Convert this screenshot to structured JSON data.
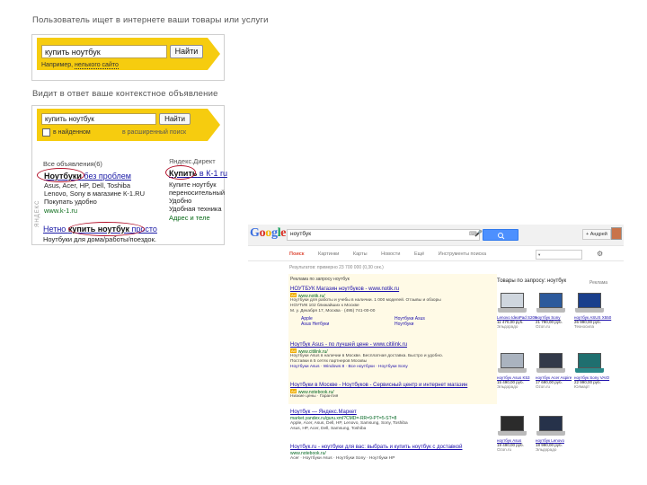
{
  "yandex": {
    "caption_top": "Пользователь ищет в интернете ваши товары или услуги",
    "caption_mid": "Видит в ответ ваше контекстное объявление",
    "box1": {
      "query": "купить ноутбук",
      "button": "Найти",
      "hint_prefix": "Например, ",
      "hint_link": "нелького сайто"
    },
    "box2": {
      "query": "купить ноутбук",
      "button": "Найти",
      "checkbox_label": "в найденном",
      "hint": "в расширенный поиск",
      "left_header": "Все объявления(6)",
      "ad1_title_link": "Ноутбуки",
      "ad1_title_rest": " без проблем",
      "ad1_lines": [
        "Asus, Acer, HP, Dell, Toshiba",
        "Lenovo, Sony в магазине К-1.RU",
        "Покупать удобно"
      ],
      "ad1_url": "www.k-1.ru",
      "right_header": "Яндекс.Директ",
      "ad2_title_link": "Купить",
      "ad2_title_rest": " в К-1 ru",
      "ad2_lines": [
        "Купите ноутбук",
        "переносительный",
        "Удобно",
        "Удобная техника"
      ],
      "ad2_url": "Адрес и теле",
      "ad3_title_prefix": "Нетно ",
      "ad3_title_link": "купить ноутбук",
      "ad3_title_rest": " просто",
      "ad3_line": "Ноутбуки для дома/работы/поездок.",
      "vertical_logo": "ЯНДЕКС"
    }
  },
  "google": {
    "logo": "Google",
    "query": "ноутбук",
    "user_button": "+ Андрей",
    "tabs": [
      "Поиск",
      "Картинки",
      "Карты",
      "Новости",
      "Ещё",
      "Инструменты поиска"
    ],
    "results_count": "Результатов: примерно 23 700 000 (0,30 сек.)",
    "ad_header": "Реклама по запросу ноутбук",
    "ads": [
      {
        "title": "НОУТБУК Магазин ноутбуков - www.notik.ru",
        "url": "www.notik.ru/",
        "lines": [
          "Ноутбуки для работы и учебы в наличии. 1 000 моделей. Отзывы и обзоры",
          "НОУТИК 102 ближайших к Москве",
          "М. у. Декабря 17, Москва · (495) 741-00-00"
        ],
        "sitelinks": [
          "Apple",
          "Ноутбуки Asus",
          "Asus Нетбуки",
          "Ноутбуки"
        ]
      },
      {
        "title": "Ноутбук Asus - по лучшей цене - www.citilink.ru",
        "url": "www.citilink.ru/",
        "lines": [
          "Ноутбуки Asus в наличии в Москве. Бесплатная доставка. Быстро и удобно.",
          "Поставки в 5 сетях партнеров Москвы",
          "Ноутбуки Asus · Windows 8 · Все ноутбуки · Ноутбуки Sony"
        ]
      },
      {
        "title": "Ноутбуки в Москве - Ноутбуков - Сервисный центр и интернет магазин",
        "url": "www.notebook.ru/",
        "lines": [
          "Низкие цены · Гарантия"
        ]
      }
    ],
    "organic": [
      {
        "title": "Ноутбук — Яндекс.Маркет",
        "url": "market.yandex.ru/guru.xml?CMD=-RR=9-PT=5-ST=8",
        "lines": [
          "Apple, Acer, Asus, Dell, HP, Lenovo, Samsung, Sony, Toshiba",
          "Asus, HP, Acer, Dell, Samsung, Toshiba"
        ]
      },
      {
        "title": "Ноутбук.ru - ноутбуки для вас: выбрать и купить ноутбук с доставкой",
        "url": "www.notebook.ru/",
        "lines": [
          "Acer · Ноутбуки Asus · Ноутбуки Sony · Ноутбуки HP"
        ]
      }
    ],
    "right_title": "Товары по запросу: ноутбук",
    "right_more": "Реклама",
    "products": [
      {
        "name": "Lenovo IdeaPad S206",
        "price": "11 470,00 руб.",
        "store": "Эльдорадо"
      },
      {
        "name": "ноутбук Sony",
        "price": "21 790,00 руб.",
        "store": "Ozon.ru"
      },
      {
        "name": "ноутбук ASUS X550",
        "price": "26 990,00 руб.",
        "store": "Техносила"
      },
      {
        "name": "ноутбук Asus K53",
        "price": "15 490,00 руб.",
        "store": "Эльдорадо"
      },
      {
        "name": "ноутбук Acer Aspire",
        "price": "17 690,00 руб.",
        "store": "Ozon.ru"
      },
      {
        "name": "ноутбук Sony VAIO",
        "price": "22 990,00 руб.",
        "store": "Юлмарт"
      },
      {
        "name": "ноутбук Asus",
        "price": "19 490,00 руб.",
        "store": "Ozon.ru"
      },
      {
        "name": "ноутбук Lenovo",
        "price": "18 990,00 руб.",
        "store": "Эльдорадо"
      }
    ]
  }
}
